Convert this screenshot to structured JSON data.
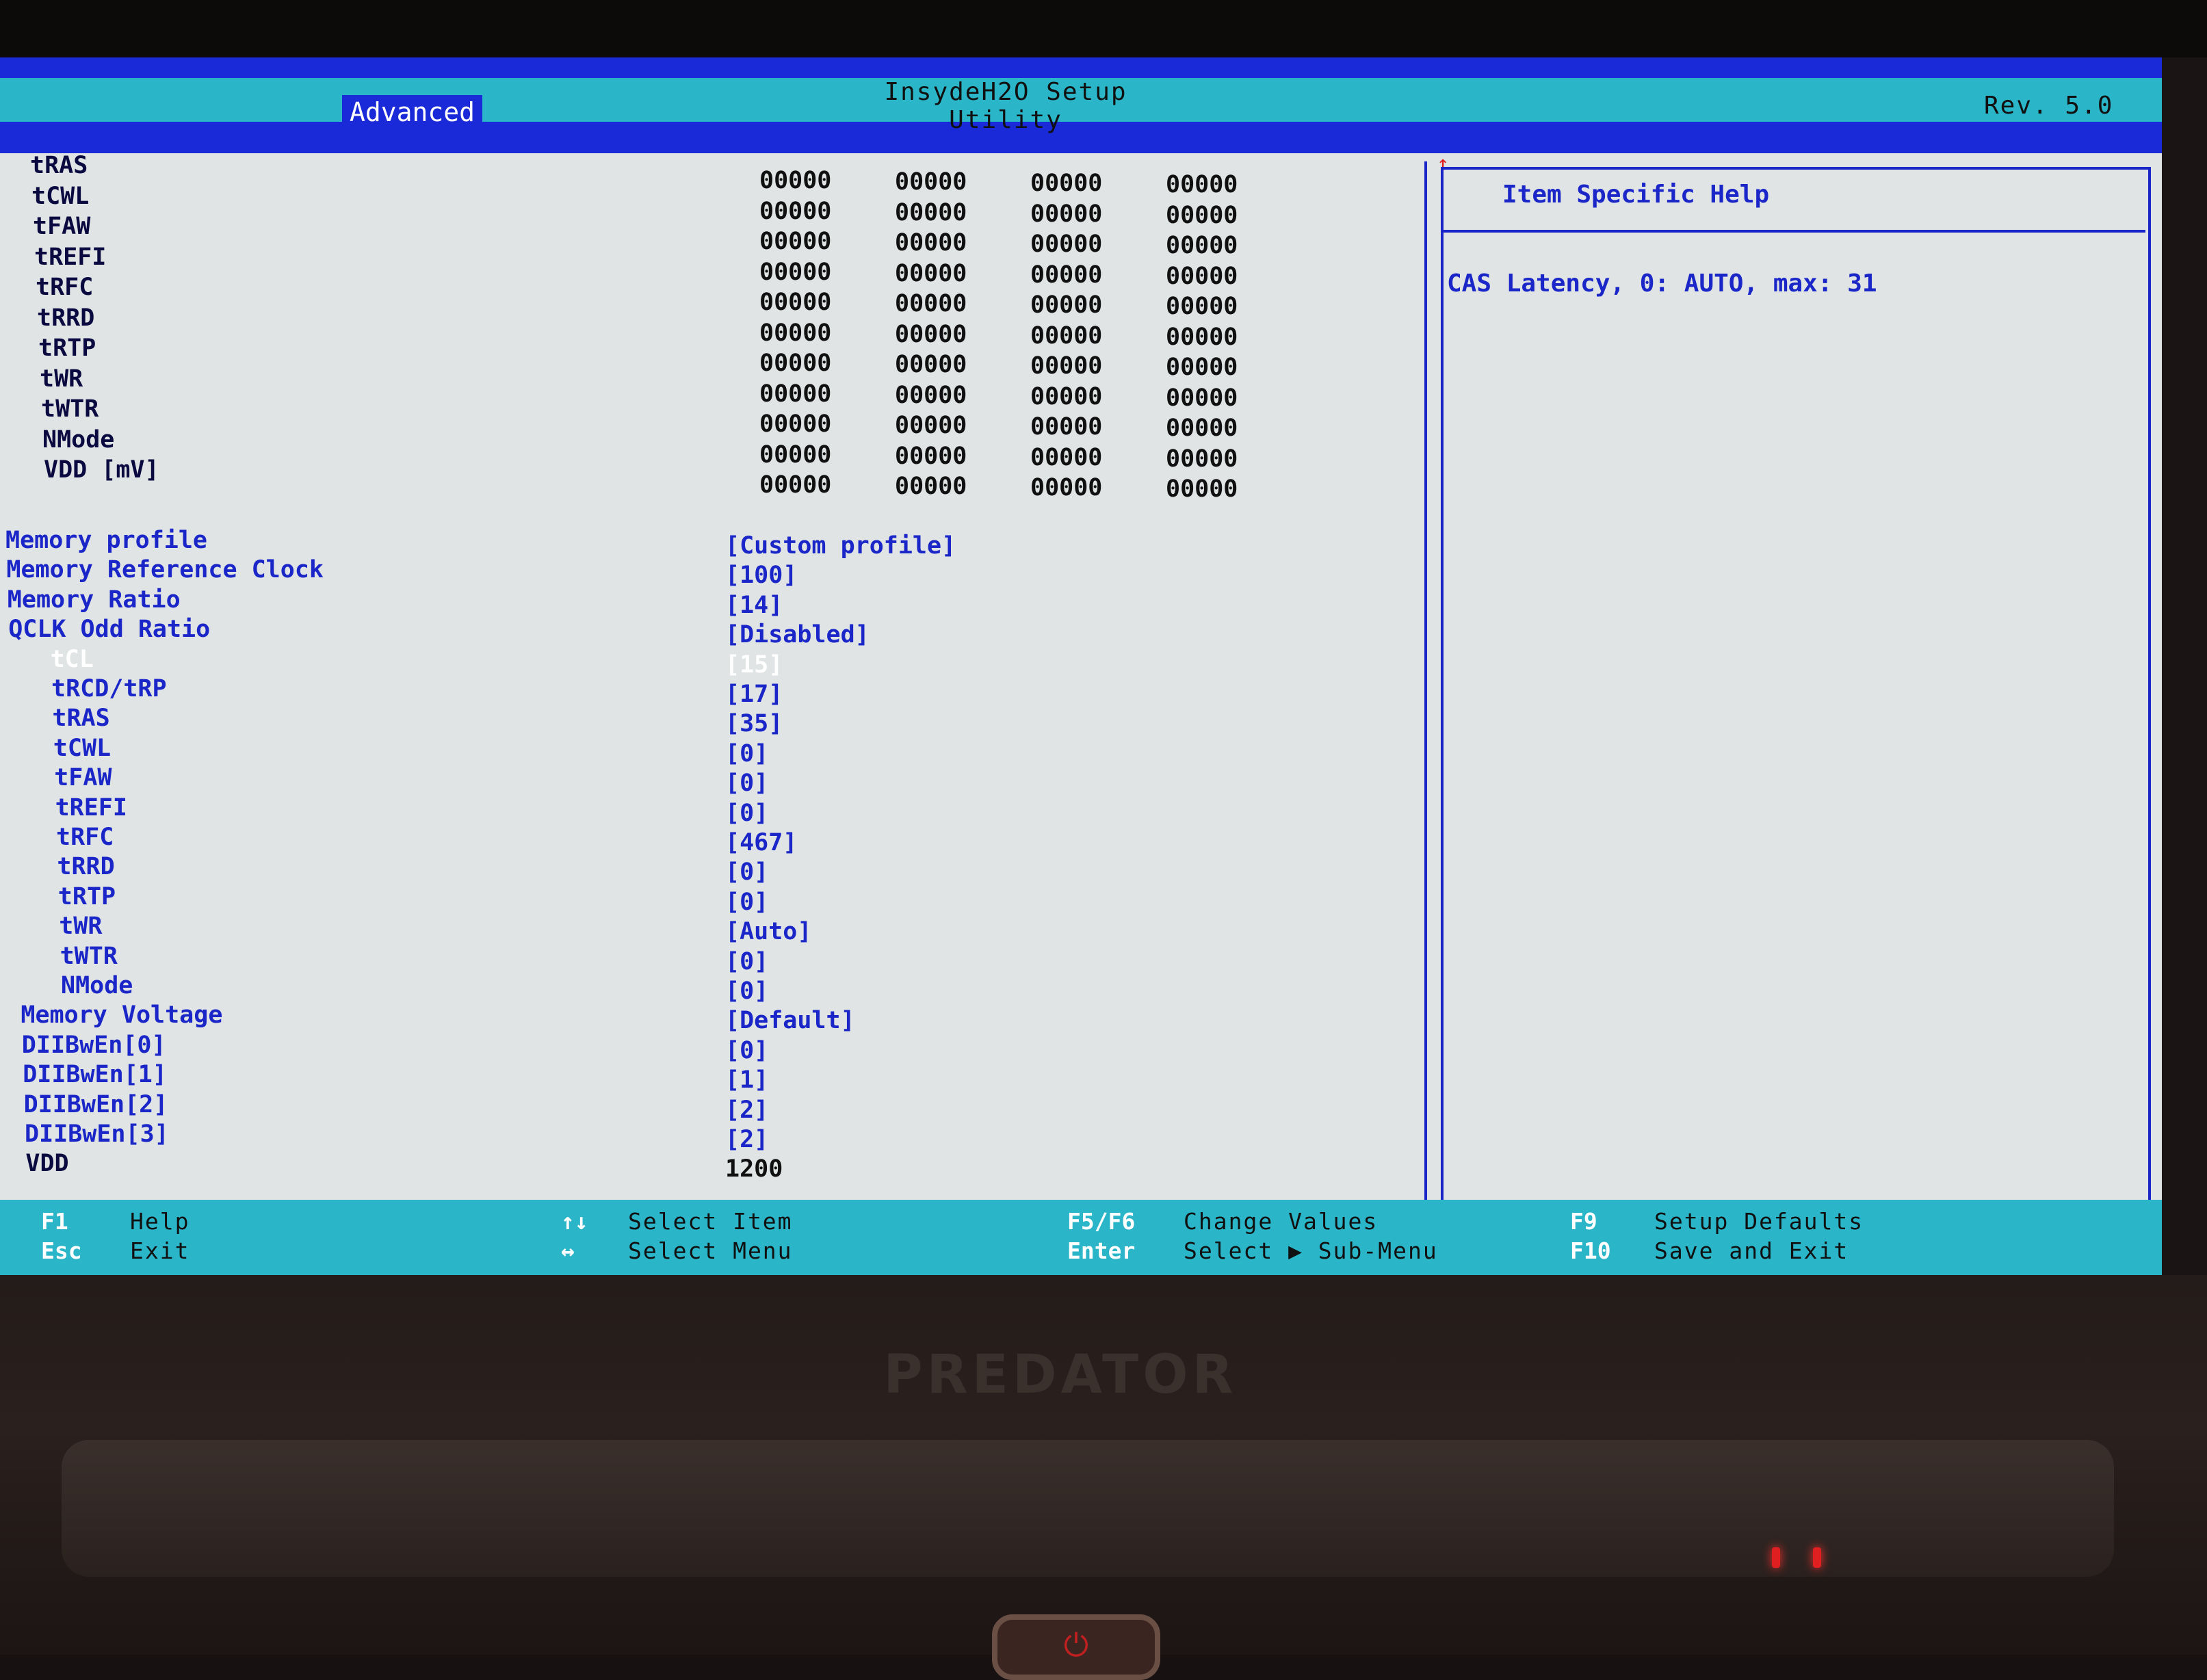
{
  "header": {
    "title": "InsydeH2O Setup Utility",
    "revision": "Rev. 5.0",
    "active_tab": "Advanced"
  },
  "spd_table": {
    "rows": [
      {
        "label": "tRAS",
        "values": [
          "00000",
          "00000",
          "00000",
          "00000"
        ]
      },
      {
        "label": "tCWL",
        "values": [
          "00000",
          "00000",
          "00000",
          "00000"
        ]
      },
      {
        "label": "tFAW",
        "values": [
          "00000",
          "00000",
          "00000",
          "00000"
        ]
      },
      {
        "label": "tREFI",
        "values": [
          "00000",
          "00000",
          "00000",
          "00000"
        ]
      },
      {
        "label": "tRFC",
        "values": [
          "00000",
          "00000",
          "00000",
          "00000"
        ]
      },
      {
        "label": "tRRD",
        "values": [
          "00000",
          "00000",
          "00000",
          "00000"
        ]
      },
      {
        "label": "tRTP",
        "values": [
          "00000",
          "00000",
          "00000",
          "00000"
        ]
      },
      {
        "label": "tWR",
        "values": [
          "00000",
          "00000",
          "00000",
          "00000"
        ]
      },
      {
        "label": "tWTR",
        "values": [
          "00000",
          "00000",
          "00000",
          "00000"
        ]
      },
      {
        "label": "NMode",
        "values": [
          "00000",
          "00000",
          "00000",
          "00000"
        ]
      },
      {
        "label": "VDD [mV]",
        "values": [
          "00000",
          "00000",
          "00000",
          "00000"
        ]
      }
    ]
  },
  "settings": [
    {
      "label": "Memory profile",
      "value": "[Custom profile]",
      "indent": false,
      "selected": false
    },
    {
      "label": "Memory Reference Clock",
      "value": "[100]",
      "indent": false,
      "selected": false
    },
    {
      "label": "Memory Ratio",
      "value": "[14]",
      "indent": false,
      "selected": false
    },
    {
      "label": "QCLK Odd Ratio",
      "value": "[Disabled]",
      "indent": false,
      "selected": false
    },
    {
      "label": "tCL",
      "value": "[15]",
      "indent": true,
      "selected": true
    },
    {
      "label": "tRCD/tRP",
      "value": "[17]",
      "indent": true,
      "selected": false
    },
    {
      "label": "tRAS",
      "value": "[35]",
      "indent": true,
      "selected": false
    },
    {
      "label": "tCWL",
      "value": "[0]",
      "indent": true,
      "selected": false
    },
    {
      "label": "tFAW",
      "value": "[0]",
      "indent": true,
      "selected": false
    },
    {
      "label": "tREFI",
      "value": "[0]",
      "indent": true,
      "selected": false
    },
    {
      "label": "tRFC",
      "value": "[467]",
      "indent": true,
      "selected": false
    },
    {
      "label": "tRRD",
      "value": "[0]",
      "indent": true,
      "selected": false
    },
    {
      "label": "tRTP",
      "value": "[0]",
      "indent": true,
      "selected": false
    },
    {
      "label": "tWR",
      "value": "[Auto]",
      "indent": true,
      "selected": false
    },
    {
      "label": "tWTR",
      "value": "[0]",
      "indent": true,
      "selected": false
    },
    {
      "label": "NMode",
      "value": "[0]",
      "indent": true,
      "selected": false
    },
    {
      "label": "Memory Voltage",
      "value": "[Default]",
      "indent": false,
      "selected": false
    },
    {
      "label": "DIIBwEn[0]",
      "value": "[0]",
      "indent": false,
      "selected": false
    },
    {
      "label": "DIIBwEn[1]",
      "value": "[1]",
      "indent": false,
      "selected": false
    },
    {
      "label": "DIIBwEn[2]",
      "value": "[2]",
      "indent": false,
      "selected": false
    },
    {
      "label": "DIIBwEn[3]",
      "value": "[2]",
      "indent": false,
      "selected": false
    },
    {
      "label": "VDD",
      "value": "1200",
      "indent": false,
      "selected": false,
      "readonly": true
    }
  ],
  "help": {
    "title": "Item Specific Help",
    "text": "CAS Latency, 0: AUTO, max: 31"
  },
  "footer": [
    {
      "key": "F1",
      "desc": "Help"
    },
    {
      "key": "Esc",
      "desc": "Exit"
    },
    {
      "key": "↑↓",
      "desc": "Select Item"
    },
    {
      "key": "↔",
      "desc": "Select Menu"
    },
    {
      "key": "F5/F6",
      "desc": "Change Values"
    },
    {
      "key": "Enter",
      "desc": "Select ▶ Sub-Menu"
    },
    {
      "key": "F9",
      "desc": "Setup Defaults"
    },
    {
      "key": "F10",
      "desc": "Save and Exit"
    }
  ],
  "device": {
    "brand": "PREDATOR"
  },
  "colors": {
    "bios_blue": "#1a2ad8",
    "bios_cyan": "#2ab6c8",
    "screen_bg": "#e0e4e4"
  }
}
